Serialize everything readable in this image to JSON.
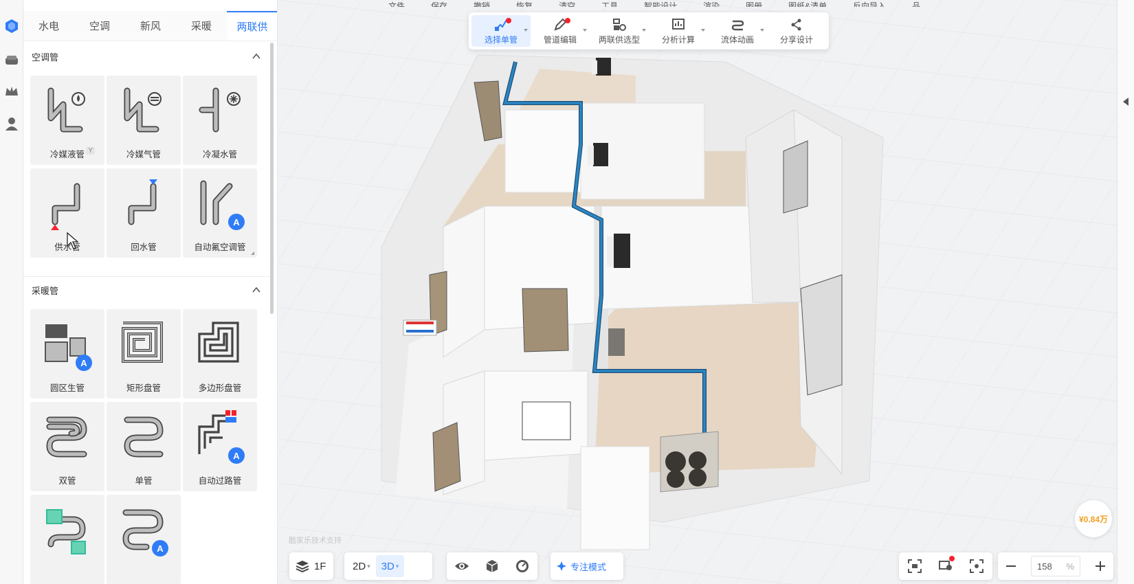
{
  "topmenu": [
    "文件",
    "保存",
    "撤销",
    "恢复",
    "清空",
    "工具",
    "智能设计",
    "渲染",
    "图册",
    "图纸&清单",
    "反向导入",
    "品库"
  ],
  "tabs": [
    {
      "label": "水电",
      "active": false
    },
    {
      "label": "空调",
      "active": false
    },
    {
      "label": "新风",
      "active": false
    },
    {
      "label": "采暖",
      "active": false
    },
    {
      "label": "两联供",
      "active": true
    }
  ],
  "sections": {
    "ac": {
      "title": "空调管",
      "items": [
        {
          "label": "冷媒液管",
          "icon": "refrigerant-liquid-pipe-icon",
          "shortcut": "Y"
        },
        {
          "label": "冷媒气管",
          "icon": "refrigerant-gas-pipe-icon"
        },
        {
          "label": "冷凝水管",
          "icon": "condensate-pipe-icon"
        },
        {
          "label": "供水管",
          "icon": "supply-pipe-icon"
        },
        {
          "label": "回水管",
          "icon": "return-pipe-icon"
        },
        {
          "label": "自动氟空调管",
          "icon": "auto-ac-pipe-icon"
        }
      ]
    },
    "heating": {
      "title": "采暖管",
      "items": [
        {
          "label": "圆区生管",
          "icon": "zone-pipe-icon"
        },
        {
          "label": "矩形盘管",
          "icon": "rect-coil-icon"
        },
        {
          "label": "多边形盘管",
          "icon": "polygon-coil-icon"
        },
        {
          "label": "双管",
          "icon": "double-pipe-icon"
        },
        {
          "label": "单管",
          "icon": "single-pipe-icon"
        },
        {
          "label": "自动过路管",
          "icon": "auto-pass-pipe-icon"
        },
        {
          "label": "",
          "icon": "connector-pipe-icon"
        },
        {
          "label": "",
          "icon": "auto-coil-icon"
        }
      ]
    }
  },
  "toolbar": [
    {
      "label": "选择单管",
      "active": true,
      "dot": true,
      "caret": true,
      "icon": "select-pipe-icon"
    },
    {
      "label": "管道编辑",
      "active": false,
      "dot": true,
      "caret": true,
      "icon": "pipe-edit-icon"
    },
    {
      "label": "两联供选型",
      "active": false,
      "dot": false,
      "caret": true,
      "icon": "selection-icon"
    },
    {
      "label": "分析计算",
      "active": false,
      "dot": false,
      "caret": true,
      "icon": "analysis-icon"
    },
    {
      "label": "流体动画",
      "active": false,
      "dot": false,
      "caret": true,
      "icon": "fluid-animation-icon"
    },
    {
      "label": "分享设计",
      "active": false,
      "dot": false,
      "caret": false,
      "icon": "share-icon"
    }
  ],
  "bottombar": {
    "floor": "1F",
    "view2d": "2D",
    "view3d": "3D",
    "focus": "专注模式",
    "zoom": "158",
    "zoom_unit": "%"
  },
  "price": "¥0.84万",
  "watermark": "酷家乐技术支持",
  "colors": {
    "accent": "#2f7cf6",
    "pipe": "#2b86c5",
    "price": "#f0a020",
    "alert": "#f5222d"
  }
}
